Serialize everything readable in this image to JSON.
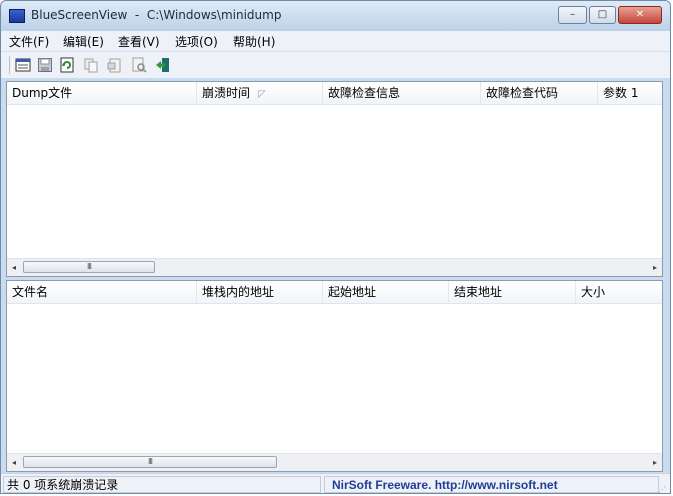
{
  "window": {
    "title": "BlueScreenView  -  C:\\Windows\\minidump",
    "min_symbol": "–",
    "max_symbol": "□",
    "close_symbol": "✕"
  },
  "menu": {
    "items": [
      {
        "label": "文件(F)"
      },
      {
        "label": "编辑(E)"
      },
      {
        "label": "查看(V)"
      },
      {
        "label": "选项(O)"
      },
      {
        "label": "帮助(H)"
      }
    ]
  },
  "toolbar": {
    "icons": [
      "properties-icon",
      "save-icon",
      "refresh-icon",
      "copy-icon",
      "html-report-icon",
      "find-icon",
      "exit-icon"
    ]
  },
  "top_pane": {
    "columns": [
      {
        "label": "Dump文件"
      },
      {
        "label": "崩溃时间"
      },
      {
        "label": "故障检查信息"
      },
      {
        "label": "故障检查代码"
      },
      {
        "label": "参数 1"
      }
    ],
    "sort_glyph": "◸",
    "rows": []
  },
  "bottom_pane": {
    "columns": [
      {
        "label": "文件名"
      },
      {
        "label": "堆栈内的地址"
      },
      {
        "label": "起始地址"
      },
      {
        "label": "结束地址"
      },
      {
        "label": "大小"
      }
    ],
    "rows": []
  },
  "scrollbar": {
    "left_arrow": "◂",
    "right_arrow": "▸",
    "grip": "III"
  },
  "status": {
    "left_text": "共 0 项系统崩溃记录",
    "right_text": "NirSoft Freeware.  http://www.nirsoft.net",
    "right_color": "#1f3e95"
  }
}
